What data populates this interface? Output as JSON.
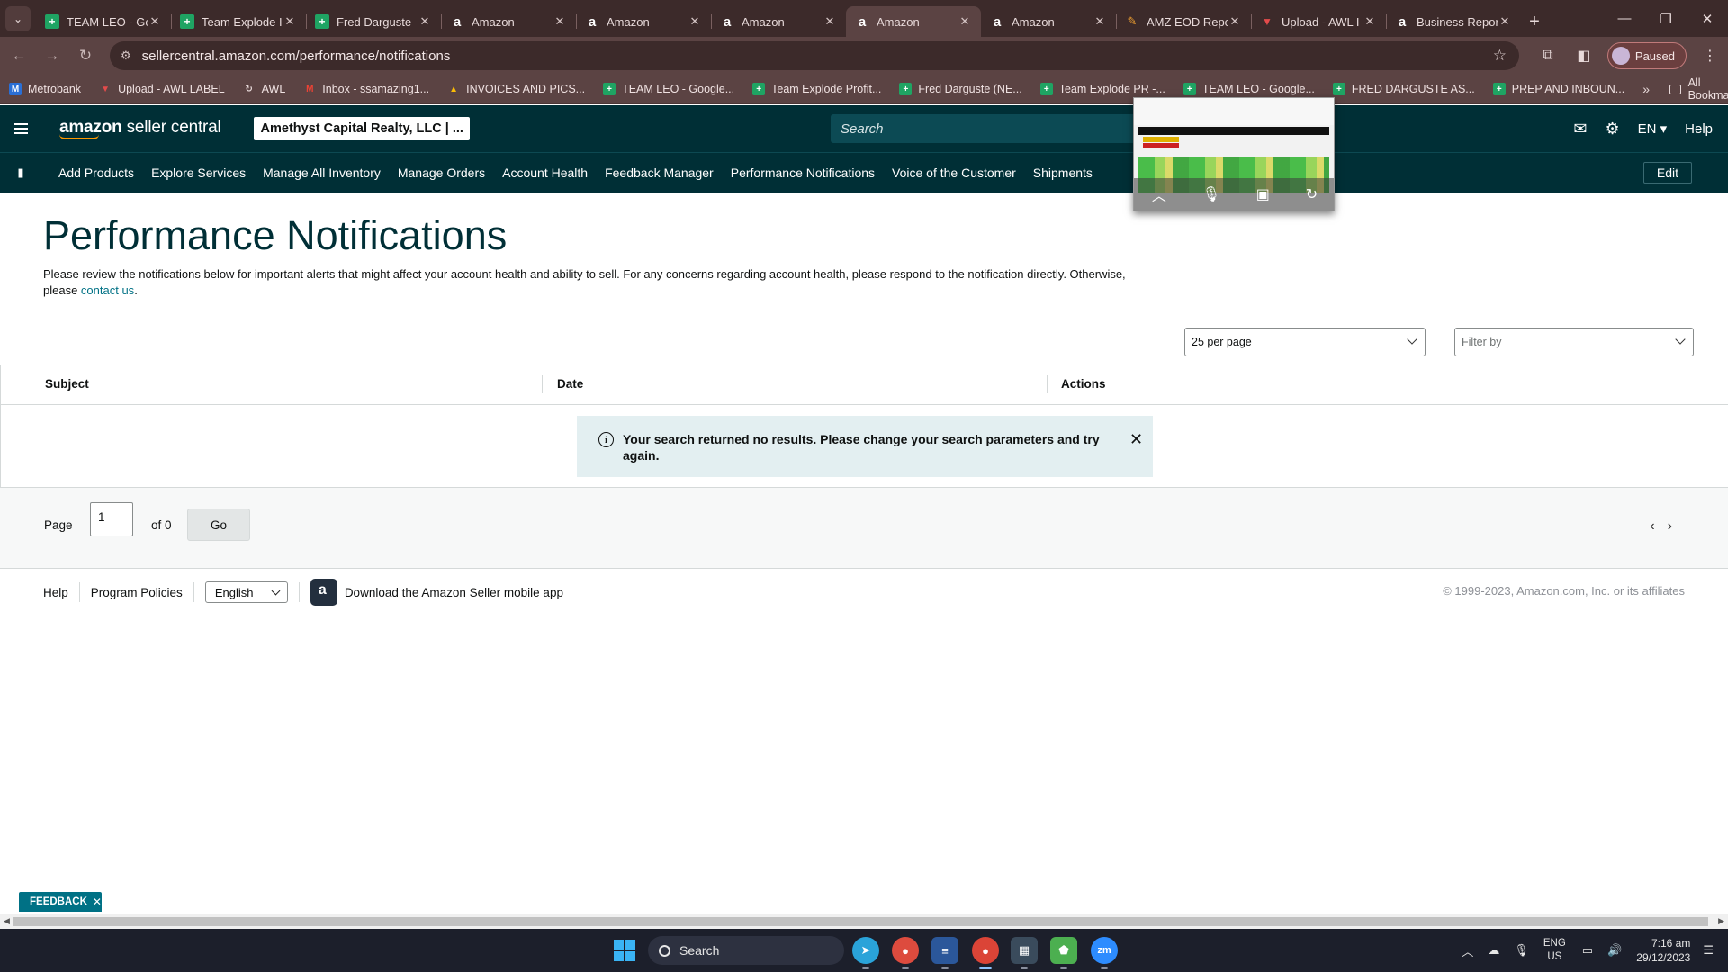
{
  "browser": {
    "tabs": [
      {
        "title": "TEAM LEO - Go",
        "icon": "sheets-icon",
        "active": false
      },
      {
        "title": "Team Explode I",
        "icon": "sheets-icon",
        "active": false
      },
      {
        "title": "Fred Darguste",
        "icon": "sheets-icon",
        "active": false
      },
      {
        "title": "Amazon",
        "icon": "amazon-icon",
        "active": false
      },
      {
        "title": "Amazon",
        "icon": "amazon-icon",
        "active": false
      },
      {
        "title": "Amazon",
        "icon": "amazon-icon",
        "active": false
      },
      {
        "title": "Amazon",
        "icon": "amazon-icon",
        "active": true
      },
      {
        "title": "Amazon",
        "icon": "amazon-icon",
        "active": false
      },
      {
        "title": "AMZ EOD Repo",
        "icon": "pen-icon",
        "active": false
      },
      {
        "title": "Upload - AWL I",
        "icon": "pdf-icon",
        "active": false
      },
      {
        "title": "Business Repor",
        "icon": "amazon-icon",
        "active": false
      }
    ],
    "url": "sellercentral.amazon.com/performance/notifications",
    "profile_status": "Paused",
    "bookmarks": [
      {
        "label": "Metrobank",
        "icon": "mb"
      },
      {
        "label": "Upload - AWL LABEL",
        "icon": "pdf"
      },
      {
        "label": "AWL",
        "icon": "awl"
      },
      {
        "label": "Inbox - ssamazing1...",
        "icon": "gm"
      },
      {
        "label": "INVOICES AND PICS...",
        "icon": "gd"
      },
      {
        "label": "TEAM LEO - Google...",
        "icon": "sheet"
      },
      {
        "label": "Team Explode Profit...",
        "icon": "sheet"
      },
      {
        "label": "Fred Darguste (NE...",
        "icon": "sheet"
      },
      {
        "label": "Team Explode PR -...",
        "icon": "sheet"
      },
      {
        "label": "TEAM LEO - Google...",
        "icon": "sheet"
      },
      {
        "label": "FRED DARGUSTE AS...",
        "icon": "sheet"
      },
      {
        "label": "PREP AND INBOUN...",
        "icon": "sheet"
      }
    ],
    "more_bookmarks": "»",
    "all_bookmarks": "All Bookmarks"
  },
  "header": {
    "logo_bold": "amazon",
    "logo_rest": " seller central",
    "account": "Amethyst Capital Realty, LLC | ...",
    "search_placeholder": "Search",
    "language": "EN",
    "help": "Help"
  },
  "nav": {
    "links": [
      "Add Products",
      "Explore Services",
      "Manage All Inventory",
      "Manage Orders",
      "Account Health",
      "Feedback Manager",
      "Performance Notifications",
      "Voice of the Customer",
      "Shipments"
    ],
    "edit": "Edit"
  },
  "page": {
    "title": "Performance Notifications",
    "description": "Please review the notifications below for important alerts that might affect your account health and ability to sell. For any concerns regarding account health, please respond to the notification directly. Otherwise, please ",
    "contact_link": "contact us",
    "description_end": ".",
    "per_page": "25 per page",
    "filter_placeholder": "Filter by"
  },
  "table": {
    "columns": [
      "Subject",
      "Date",
      "Actions"
    ],
    "alert": "Your search returned no results. Please change your search parameters and try again."
  },
  "pager": {
    "label": "Page",
    "current": "1",
    "of": "of 0",
    "go": "Go"
  },
  "footer": {
    "help": "Help",
    "policies": "Program Policies",
    "language": "English",
    "app_download": "Download the Amazon Seller mobile app",
    "copyright": "© 1999-2023, Amazon.com, Inc. or its affiliates"
  },
  "feedback": "FEEDBACK",
  "taskbar": {
    "search": "Search",
    "lang_top": "ENG",
    "lang_bottom": "US",
    "time": "7:16 am",
    "date": "29/12/2023"
  }
}
